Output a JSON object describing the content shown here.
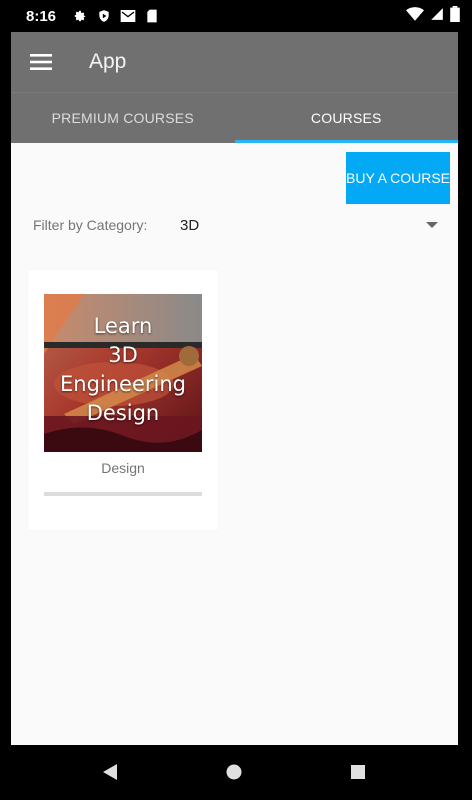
{
  "status_bar": {
    "time": "8:16",
    "left_icons": [
      "gear-icon",
      "shield-play-icon",
      "gmail-icon",
      "sd-card-icon"
    ],
    "right_icons": [
      "wifi-icon",
      "signal-icon",
      "battery-icon"
    ]
  },
  "toolbar": {
    "menu_icon": "hamburger-menu-icon",
    "title": "App"
  },
  "tabs": [
    {
      "label": "PREMIUM COURSES",
      "active": false
    },
    {
      "label": "COURSES",
      "active": true
    }
  ],
  "colors": {
    "toolbar": "#707070",
    "accent": "#03a9f4",
    "tab_indicator": "#29b6f6",
    "background": "#fafafa"
  },
  "buy_button": {
    "label": "BUY A COURSE"
  },
  "filter": {
    "label": "Filter by Category:",
    "selected": "3D"
  },
  "courses": [
    {
      "thumbnail_lines": [
        "Learn",
        "3D",
        "Engineering",
        "Design"
      ],
      "category": "Design",
      "progress": 0
    }
  ],
  "nav_bar": {
    "icons": [
      "back-icon",
      "home-icon",
      "recents-icon"
    ]
  }
}
